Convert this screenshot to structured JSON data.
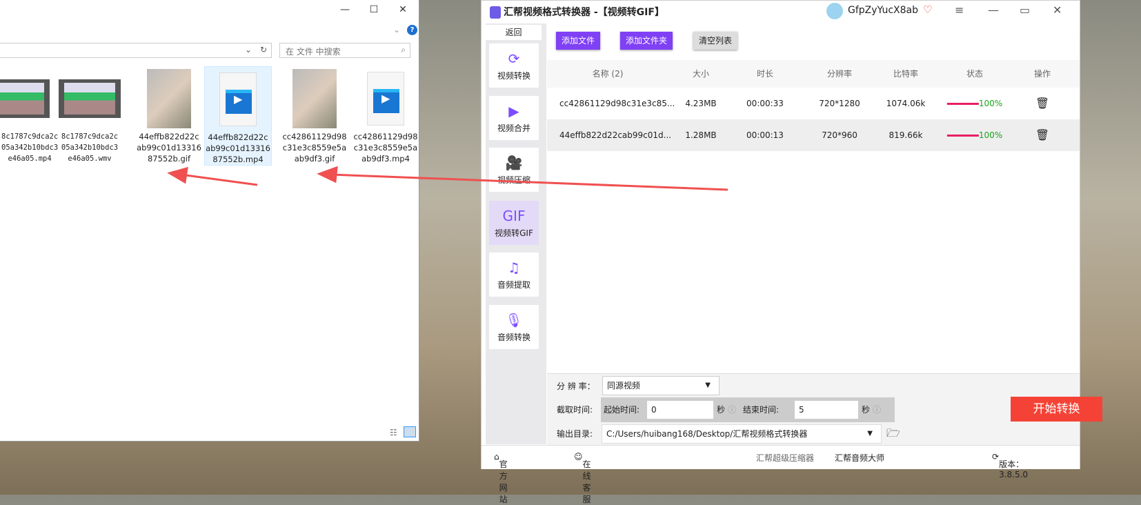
{
  "explorer": {
    "search_placeholder": "在 文件 中搜索",
    "files": [
      {
        "name": "8c1787c9dca2c05a342b10bdc3e46a05.mp4",
        "l1": "c1787c9dca2c",
        "l2": "5a342b10bdc",
        "l3": "e46a05.mp4",
        "type": "film"
      },
      {
        "name": "8c1787c9dca2c05a342b10bdc3e46a05.wmv",
        "l1": "8c1787c9dca2c",
        "l2": "05a342b10bdc",
        "l3": "3e46a05.wmv",
        "type": "film"
      },
      {
        "name": "44effb822d22cab99c01d1331687552b.gif",
        "l1": "44effb822d22c",
        "l2": "ab99c01d13316",
        "l3": "87552b.gif",
        "type": "photo"
      },
      {
        "name": "44effb822d22cab99c01d1331687552b.mp4",
        "l1": "44effb822d22c",
        "l2": "ab99c01d13316",
        "l3": "87552b.mp4",
        "type": "doc"
      },
      {
        "name": "cc42861129d98c31e3c8559e5aab9df3.gif",
        "l1": "cc42861129d98",
        "l2": "c31e3c8559e5a",
        "l3": "ab9df3.gif",
        "type": "photo"
      },
      {
        "name": "cc42861129d98c31e3c8559e5aab9df3.mp4",
        "l1": "cc42861129d98",
        "l2": "c31e3c8559e5a",
        "l3": "ab9df3.mp4",
        "type": "doc"
      }
    ]
  },
  "app": {
    "title": "汇帮视频格式转换器  -【视频转GIF】",
    "user": "GfpZyYucX8ab",
    "back": "返回",
    "sidebar": [
      {
        "label": "视频转换",
        "icon": "video-convert-icon"
      },
      {
        "label": "视频合并",
        "icon": "video-merge-icon"
      },
      {
        "label": "视频压缩",
        "icon": "video-compress-icon"
      },
      {
        "label": "视频转GIF",
        "icon": "gif-icon",
        "active": true
      },
      {
        "label": "音频提取",
        "icon": "music-icon"
      },
      {
        "label": "音频转换",
        "icon": "microphone-icon"
      }
    ],
    "toolbar": {
      "add_file": "添加文件",
      "add_folder": "添加文件夹",
      "clear": "清空列表"
    },
    "table": {
      "headers": [
        "名称 (2)",
        "大小",
        "时长",
        "分辨率",
        "比特率",
        "状态",
        "操作"
      ],
      "rows": [
        [
          "cc42861129d98c31e3c85...",
          "4.23MB",
          "00:00:33",
          "720*1280",
          "1074.06k",
          "100%"
        ],
        [
          "44effb822d22cab99c01d...",
          "1.28MB",
          "00:00:13",
          "720*960",
          "819.66k",
          "100%"
        ]
      ]
    },
    "settings": {
      "resolution_label": "分 辨 率：",
      "resolution_value": "同源视频",
      "clip_label": "截取时间:",
      "start_label": "起始时间:",
      "start_value": "0",
      "sec": "秒",
      "end_label": "结束时间:",
      "end_value": "5",
      "output_label": "输出目录:",
      "output_value": "C:/Users/huibang168/Desktop/汇帮视频格式转换器",
      "start_button": "开始转换"
    },
    "footer": {
      "website": "官方网站",
      "service": "在线客服",
      "compressor": "汇帮超级压缩器",
      "audio": "汇帮音频大师",
      "version": "版本：3.8.5.0"
    },
    "colors": {
      "accent": "#8040f5",
      "start": "#f44336",
      "progress": "#e91e63",
      "arrow": "#f05050"
    }
  }
}
